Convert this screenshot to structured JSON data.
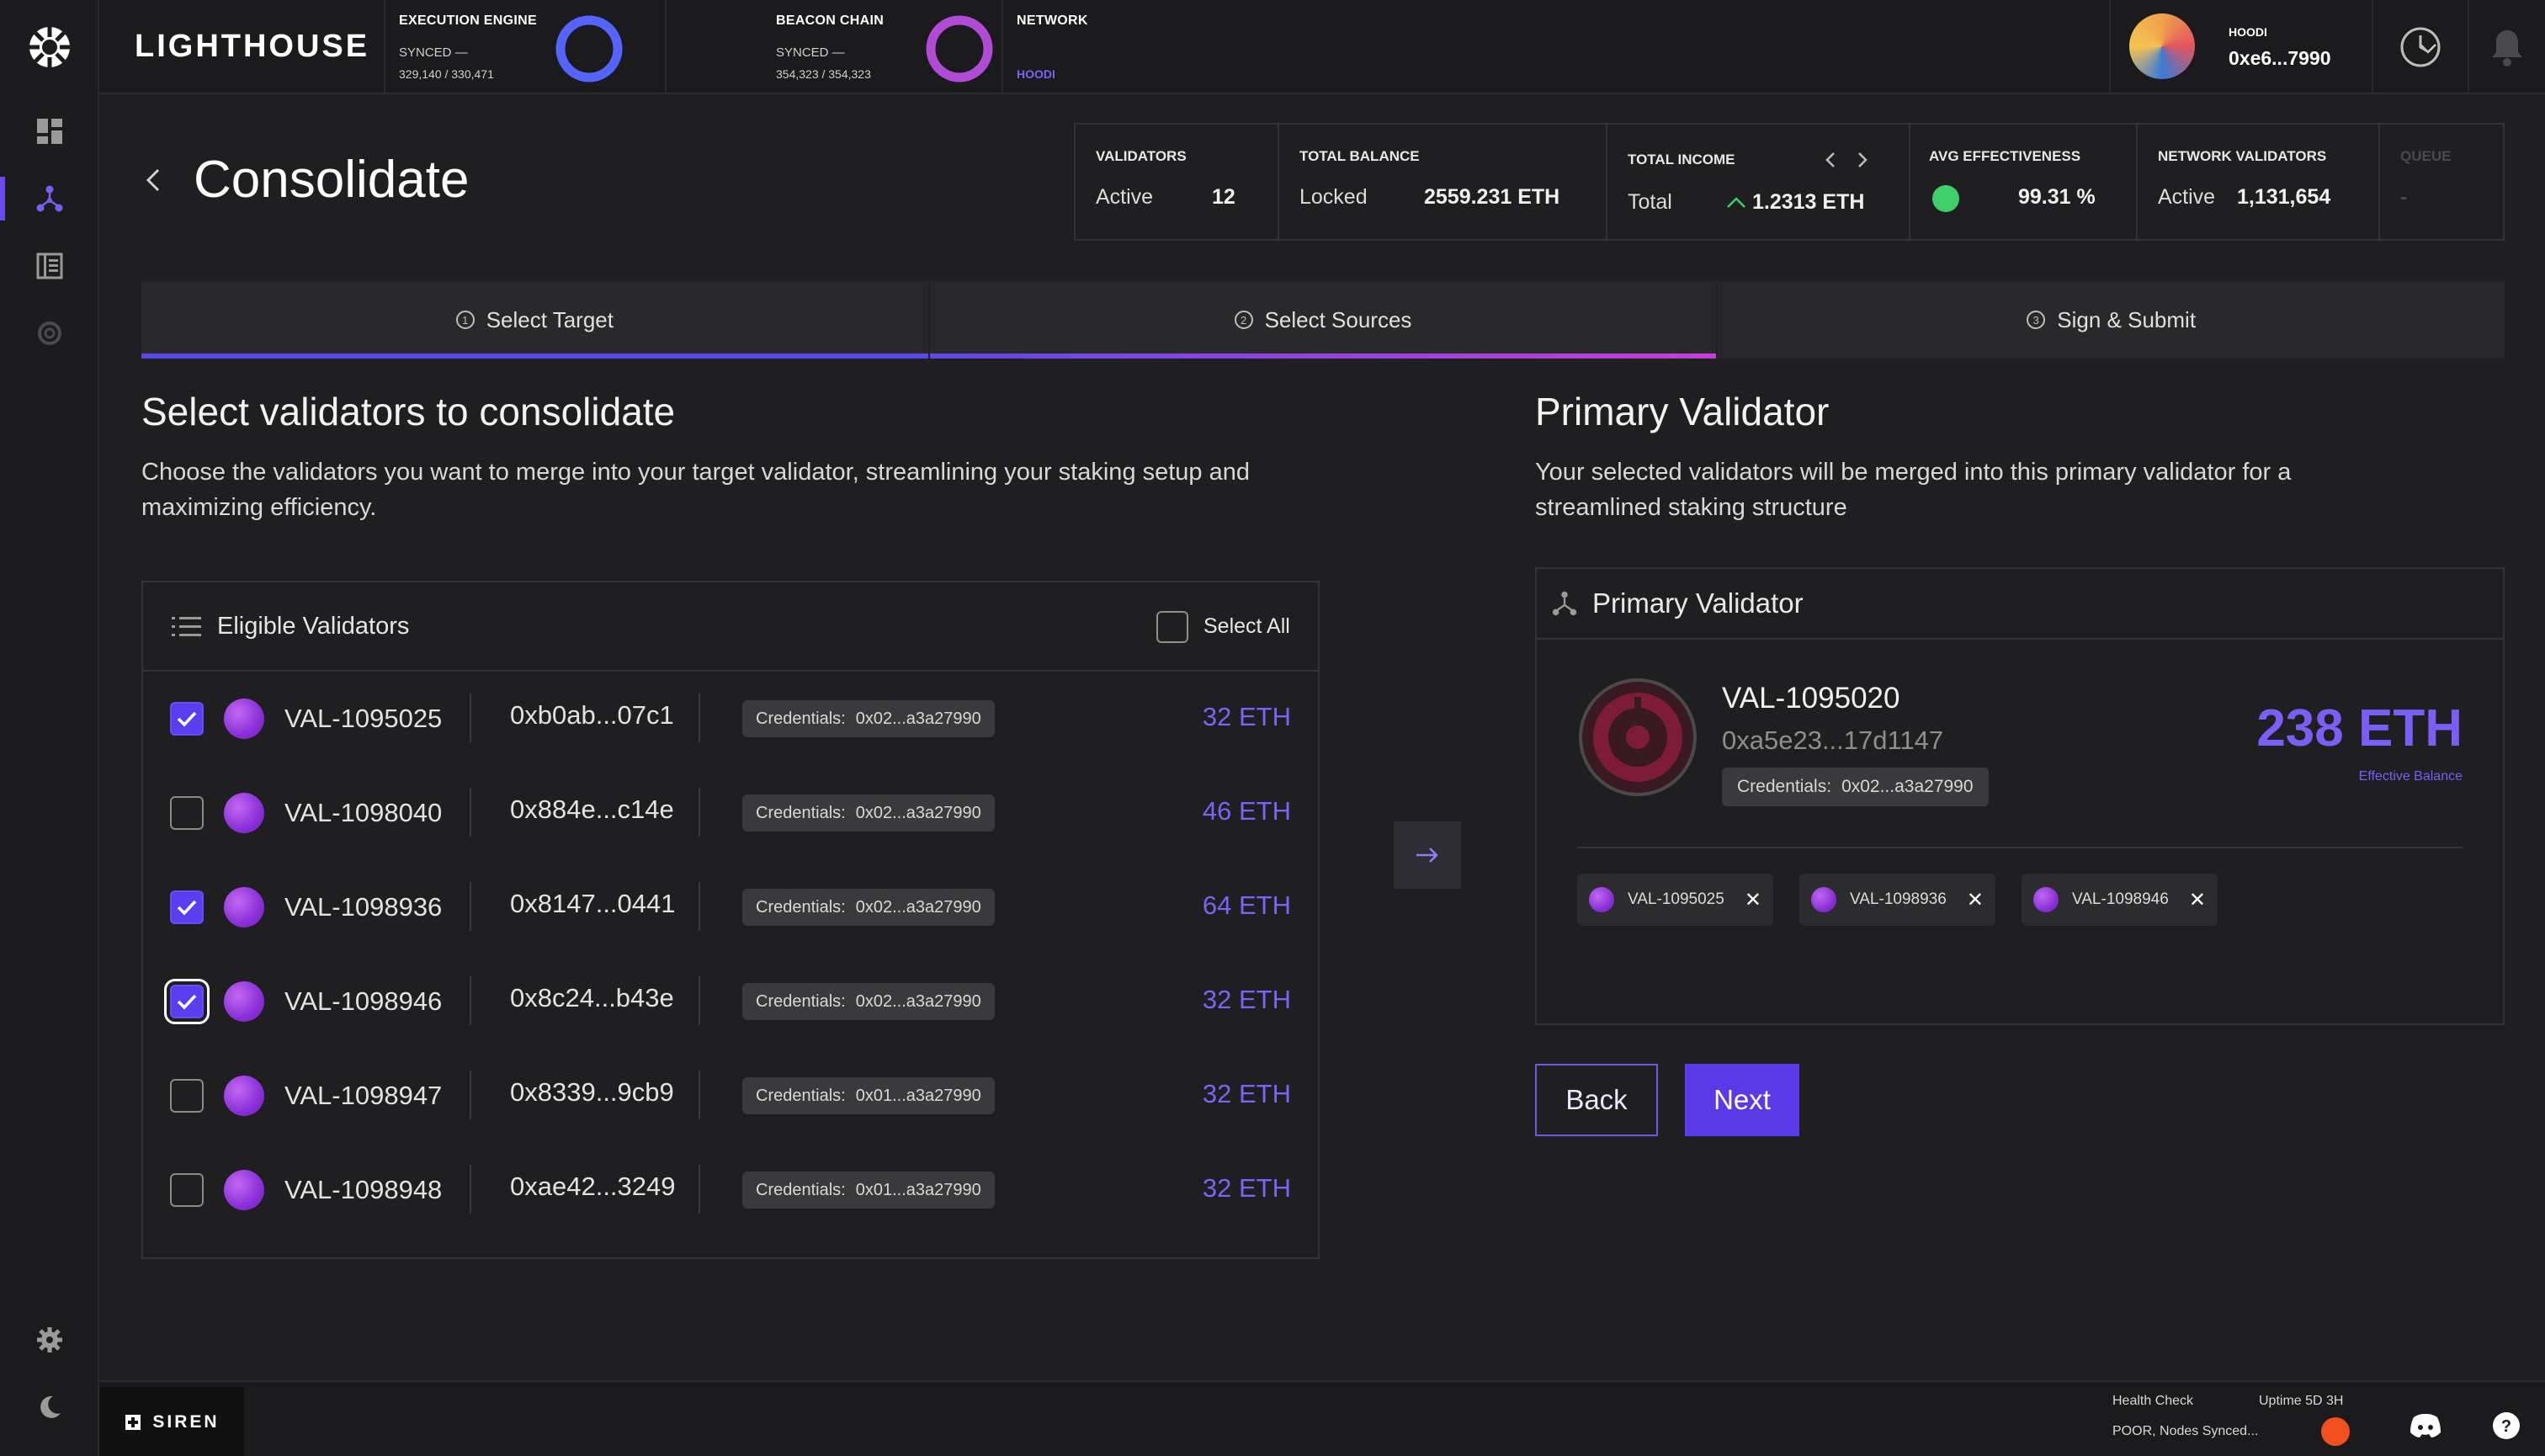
{
  "app": {
    "brand": "LIGHTHOUSE",
    "footer_brand": "SIREN"
  },
  "topbar": {
    "execution": {
      "title": "EXECUTION ENGINE",
      "status": "SYNCED —",
      "progress": "329,140 / 330,471",
      "fraction": 0.996
    },
    "beacon": {
      "title": "BEACON CHAIN",
      "status": "SYNCED —",
      "progress": "354,323 / 354,323",
      "fraction": 1.0
    },
    "network": {
      "title": "NETWORK",
      "value": "HOODI"
    },
    "account": {
      "network": "HOODI",
      "address": "0xe6...7990"
    }
  },
  "page": {
    "title": "Consolidate"
  },
  "stats": [
    {
      "label": "VALIDATORS",
      "key": "Active",
      "value": "12"
    },
    {
      "label": "TOTAL BALANCE",
      "key": "Locked",
      "value": "2559.231 ETH"
    },
    {
      "label": "TOTAL INCOME",
      "key": "Total",
      "value": "1.2313 ETH"
    },
    {
      "label": "AVG EFFECTIVENESS",
      "key": "",
      "value": "99.31 %"
    },
    {
      "label": "NETWORK VALIDATORS",
      "key": "Active",
      "value": "1,131,654"
    },
    {
      "label": "QUEUE",
      "key": "",
      "value": "-"
    }
  ],
  "steps": [
    {
      "num": "1",
      "label": "Select Target"
    },
    {
      "num": "2",
      "label": "Select Sources"
    },
    {
      "num": "3",
      "label": "Sign & Submit"
    }
  ],
  "left": {
    "title": "Select validators to consolidate",
    "desc1": "Choose the validators you want to merge into your target validator, streamlining your staking setup and",
    "desc2": "maximizing efficiency.",
    "table_title": "Eligible Validators",
    "select_all": "Select All",
    "rows": [
      {
        "name": "VAL-1095025",
        "addr": "0xb0ab...07c1",
        "cred_label": "Credentials:",
        "cred": "0x02...a3a27990",
        "bal": "32 ETH",
        "checked": true
      },
      {
        "name": "VAL-1098040",
        "addr": "0x884e...c14e",
        "cred_label": "Credentials:",
        "cred": "0x02...a3a27990",
        "bal": "46 ETH",
        "checked": false
      },
      {
        "name": "VAL-1098936",
        "addr": "0x8147...0441",
        "cred_label": "Credentials:",
        "cred": "0x02...a3a27990",
        "bal": "64 ETH",
        "checked": true
      },
      {
        "name": "VAL-1098946",
        "addr": "0x8c24...b43e",
        "cred_label": "Credentials:",
        "cred": "0x02...a3a27990",
        "bal": "32 ETH",
        "checked": true
      },
      {
        "name": "VAL-1098947",
        "addr": "0x8339...9cb9",
        "cred_label": "Credentials:",
        "cred": "0x01...a3a27990",
        "bal": "32 ETH",
        "checked": false
      },
      {
        "name": "VAL-1098948",
        "addr": "0xae42...3249",
        "cred_label": "Credentials:",
        "cred": "0x01...a3a27990",
        "bal": "32 ETH",
        "checked": false
      }
    ]
  },
  "right": {
    "title": "Primary Validator",
    "desc1": "Your selected validators will be merged into this primary validator for a",
    "desc2": "streamlined staking structure",
    "card_title": "Primary Validator",
    "name": "VAL-1095020",
    "addr": "0xa5e23...17d1147",
    "cred_label": "Credentials:",
    "cred": "0x02...a3a27990",
    "balance": "238 ETH",
    "balance_label": "Effective Balance",
    "chips": [
      "VAL-1095025",
      "VAL-1098936",
      "VAL-1098946"
    ]
  },
  "buttons": {
    "back": "Back",
    "next": "Next"
  },
  "footer": {
    "health_label": "Health Check",
    "health_value": "POOR, Nodes Synced...",
    "uptime": "Uptime 5D 3H"
  },
  "colors": {
    "accent": "#5a3ae6",
    "ring_exec": "#5563ff",
    "ring_beacon": "#b14bd6",
    "health": "#f0501e",
    "good": "#3ecf6a"
  }
}
